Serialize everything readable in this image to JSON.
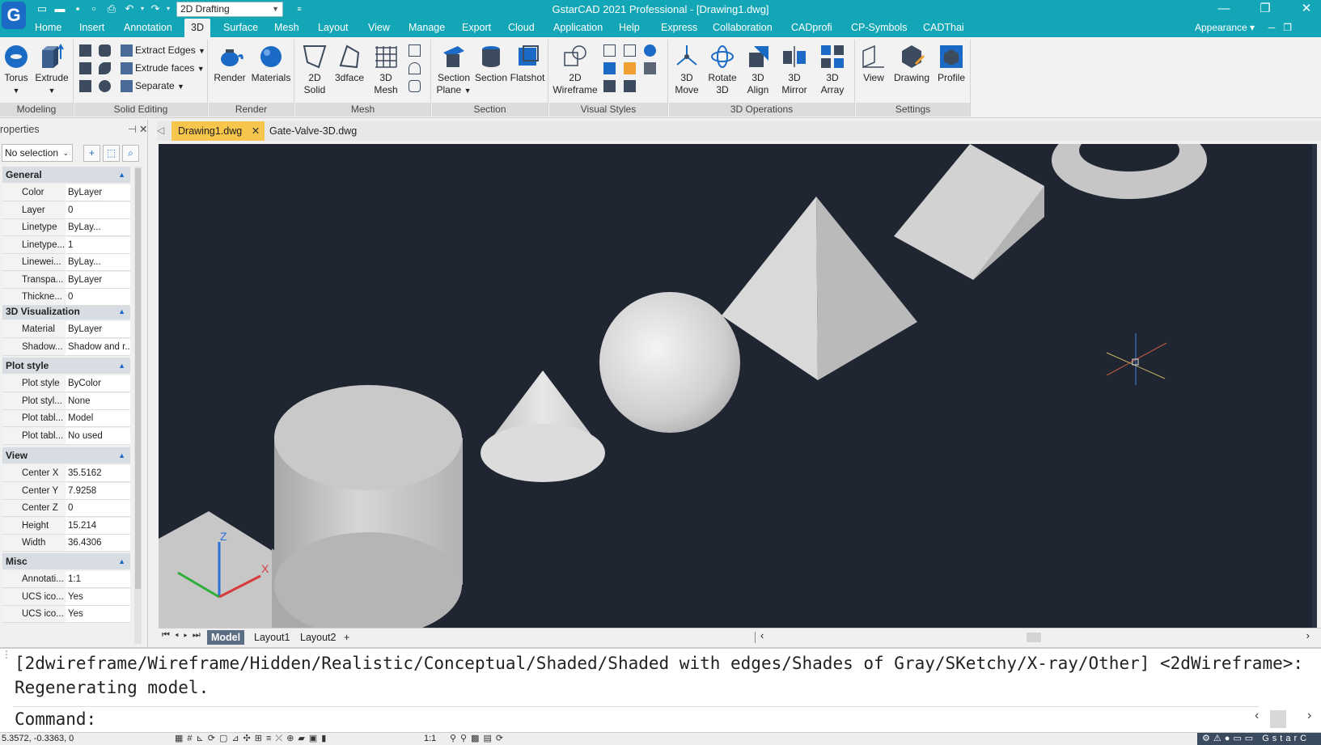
{
  "titlebar": {
    "logo": "G",
    "workspace": "2D Drafting",
    "title": "GstarCAD 2021 Professional - [Drawing1.dwg]"
  },
  "menu": {
    "items": [
      "Home",
      "Insert",
      "Annotation",
      "3D",
      "Surface",
      "Mesh",
      "Layout",
      "View",
      "Manage",
      "Export",
      "Cloud",
      "Application",
      "Help",
      "Express",
      "Collaboration",
      "CADprofi",
      "CP-Symbols",
      "CADThai"
    ],
    "active": "3D",
    "appearance": "Appearance"
  },
  "ribbon": {
    "modeling": {
      "title": "Modeling",
      "torus": "Torus",
      "extrude": "Extrude"
    },
    "solid_editing": {
      "title": "Solid Editing",
      "extract_edges": "Extract Edges",
      "extrude_faces": "Extrude faces",
      "separate": "Separate"
    },
    "render": {
      "title": "Render",
      "render": "Render",
      "materials": "Materials"
    },
    "mesh": {
      "title": "Mesh",
      "solid_2d_l1": "2D",
      "solid_2d_l2": "Solid",
      "face_3d": "3dface",
      "mesh_3d_l1": "3D",
      "mesh_3d_l2": "Mesh"
    },
    "section": {
      "title": "Section",
      "plane_l1": "Section",
      "plane_l2": "Plane",
      "section": "Section",
      "flatshot": "Flatshot"
    },
    "visual_styles": {
      "title": "Visual Styles",
      "wire_l1": "2D",
      "wire_l2": "Wireframe"
    },
    "ops3d": {
      "title": "3D Operations",
      "move_l1": "3D",
      "move_l2": "Move",
      "rotate_l1": "Rotate",
      "rotate_l2": "3D",
      "align_l1": "3D",
      "align_l2": "Align",
      "mirror_l1": "3D",
      "mirror_l2": "Mirror",
      "array_l1": "3D",
      "array_l2": "Array"
    },
    "settings": {
      "title": "Settings",
      "view": "View",
      "drawing": "Drawing",
      "profile": "Profile"
    }
  },
  "properties": {
    "header": "roperties",
    "selection": "No selection",
    "sections": {
      "general": "General",
      "visualization": "3D Visualization",
      "plot": "Plot style",
      "view": "View",
      "misc": "Misc"
    },
    "general": [
      {
        "k": "Color",
        "v": "ByLayer"
      },
      {
        "k": "Layer",
        "v": "0"
      },
      {
        "k": "Linetype",
        "v": "ByLay..."
      },
      {
        "k": "Linetype...",
        "v": "1"
      },
      {
        "k": "Linewei...",
        "v": "ByLay..."
      },
      {
        "k": "Transpa...",
        "v": "ByLayer"
      },
      {
        "k": "Thickne...",
        "v": "0"
      }
    ],
    "visualization": [
      {
        "k": "Material",
        "v": "ByLayer"
      },
      {
        "k": "Shadow...",
        "v": "Shadow and r..."
      }
    ],
    "plot": [
      {
        "k": "Plot style",
        "v": "ByColor"
      },
      {
        "k": "Plot styl...",
        "v": "None"
      },
      {
        "k": "Plot tabl...",
        "v": "Model"
      },
      {
        "k": "Plot tabl...",
        "v": "No used"
      }
    ],
    "view": [
      {
        "k": "Center X",
        "v": "35.5162"
      },
      {
        "k": "Center Y",
        "v": "7.9258"
      },
      {
        "k": "Center Z",
        "v": "0"
      },
      {
        "k": "Height",
        "v": "15.214"
      },
      {
        "k": "Width",
        "v": "36.4306"
      }
    ],
    "misc": [
      {
        "k": "Annotati...",
        "v": "1:1"
      },
      {
        "k": "UCS ico...",
        "v": "Yes"
      },
      {
        "k": "UCS ico...",
        "v": "Yes"
      }
    ]
  },
  "doc_tabs": {
    "active": "Drawing1.dwg",
    "other": "Gate-Valve-3D.dwg"
  },
  "layout_tabs": {
    "model": "Model",
    "layout1": "Layout1",
    "layout2": "Layout2",
    "add": "+"
  },
  "ucs": {
    "z": "Z",
    "x": "X"
  },
  "command": {
    "line1": "[2dwireframe/Wireframe/Hidden/Realistic/Conceptual/Shaded/Shaded with edges/Shades of Gray/SKetchy/X-ray/Other] <2dWireframe>:",
    "line2": "Regenerating model.",
    "prompt": "Command:"
  },
  "status": {
    "coords": "5.3572, -0.3363, 0",
    "scale": "1:1",
    "brand": "GstarC"
  },
  "colors": {
    "accent": "#13a6b6",
    "active_tab": "#f6c54b",
    "viewport_bg": "#1f2531"
  }
}
